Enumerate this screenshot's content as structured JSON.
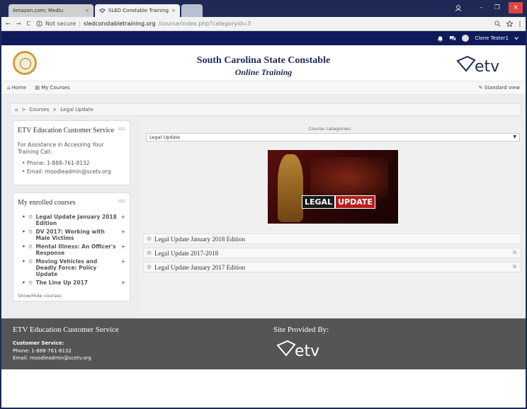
{
  "browser": {
    "tabs": [
      {
        "label": "Amazon.com: Mediu",
        "close": "×"
      },
      {
        "label": "SLED Constable Training",
        "close": "×"
      }
    ],
    "nav": {
      "back": "←",
      "forward": "→",
      "reload": "C"
    },
    "security": "Not secure",
    "url_domain": "sledconstabletraining.org",
    "url_path": "/course/index.php?categoryid=3",
    "window": {
      "minimize": "–",
      "restore": "❐",
      "close": "×"
    },
    "toolbar_icons": [
      "search-icon",
      "star-icon",
      "menu-icon"
    ]
  },
  "sitebar": {
    "user": "Clone Tester1"
  },
  "header": {
    "title_line1": "South Carolina State Constable",
    "title_line2": "Online Training",
    "logo_text": "etv"
  },
  "nav": {
    "home": "Home",
    "my_courses": "My Courses",
    "standard_view": "Standard view"
  },
  "breadcrumb": {
    "sep": ">",
    "courses": "Courses",
    "current": "Legal Update"
  },
  "service_block": {
    "title": "ETV Education Customer Service",
    "intro": "For Assistance in Accessing Your Training Call:",
    "items": [
      "Phone: 1-888-761-8132",
      "Email: moodleadmin@scetv.org"
    ]
  },
  "enrolled_block": {
    "title": "My enrolled courses",
    "courses": [
      "Legal Update January 2018 Edition",
      "DV 2017: Working with Male Victims",
      "Mental Illness: An Officer's Response",
      "Moving Vehicles and Deadly Force: Policy Update",
      "The Line Up 2017"
    ],
    "show_hide": "Show/Hide courses"
  },
  "main": {
    "category_label": "Course categories:",
    "category_selected": "Legal Update",
    "banner": {
      "word1": "LEGAL",
      "word2": "UPDATE"
    },
    "courses": [
      "Legal Update January 2018 Edition",
      "Legal Update 2017-2018",
      "Legal Update January 2017 Edition"
    ]
  },
  "footer": {
    "title": "ETV Education Customer Service",
    "cs_label": "Customer Service:",
    "phone": "Phone: 1-888-761-8132",
    "email": "Email: moodleadmin@scetv.org",
    "site_by": "Site Provided By:",
    "logo_text": "etv"
  },
  "colors": {
    "navy": "#0e1a5a",
    "footer": "#555555",
    "accent_red": "#b41e1e"
  }
}
